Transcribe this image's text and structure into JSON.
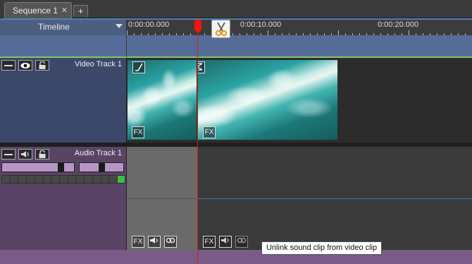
{
  "tabs": {
    "active_label": "Sequence 1",
    "close_glyph": "✕",
    "add_glyph": "+"
  },
  "header": {
    "label": "Timeline"
  },
  "ruler": {
    "labels": [
      "0:00:00.000",
      "0:00:10.000",
      "0:00:20.000"
    ]
  },
  "video_track": {
    "name": "Video Track 1",
    "icons": [
      "collapse-icon",
      "eye-icon",
      "lock-icon"
    ],
    "clip_buttons": [
      "fade-icon",
      "transition-icon",
      "FX",
      "FX"
    ]
  },
  "audio_track": {
    "name": "Audio Track 1",
    "icons": [
      "collapse-icon",
      "speaker-icon",
      "lock-icon"
    ],
    "volume_level": 0.85,
    "pan_level": 0.5,
    "clip_fx_label": "FX"
  },
  "tooltip": {
    "text": "Unlink sound clip from video clip"
  },
  "colors": {
    "playhead": "#ff1010",
    "video_header": "#3c4869",
    "audio_header": "#5a4466",
    "marker_lane": "#566c98",
    "meter_peak": "#3cbf46"
  }
}
